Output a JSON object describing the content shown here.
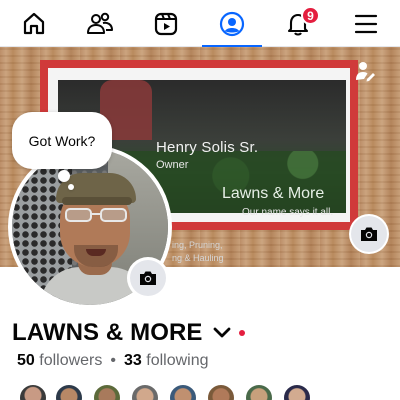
{
  "nav": {
    "items": [
      {
        "name": "home",
        "icon": "home-icon"
      },
      {
        "name": "friends",
        "icon": "friends-icon"
      },
      {
        "name": "video",
        "icon": "video-icon"
      },
      {
        "name": "profile",
        "icon": "profile-icon",
        "active": true
      },
      {
        "name": "notifications",
        "icon": "bell-icon",
        "badge": "9"
      },
      {
        "name": "menu",
        "icon": "menu-icon"
      }
    ],
    "notification_badge": "9",
    "accent_color": "#0866ff",
    "badge_color": "#e41e3f"
  },
  "cover": {
    "card": {
      "name": "Henry Solis Sr.",
      "role": "Owner",
      "brand": "Lawns & More",
      "tagline": "Our name says it all.",
      "services_line1": "ing, Pruning,",
      "services_line2": "ng & Hauling"
    },
    "edit_icon": "edit-cover-icon",
    "camera_icon": "camera-icon"
  },
  "note": {
    "text": "Got Work?"
  },
  "profile": {
    "name": "LAWNS & MORE",
    "followers_count": "50",
    "followers_label": "followers",
    "separator": "•",
    "following_count": "33",
    "following_label": "following"
  },
  "followers_preview": {
    "count": 8
  }
}
